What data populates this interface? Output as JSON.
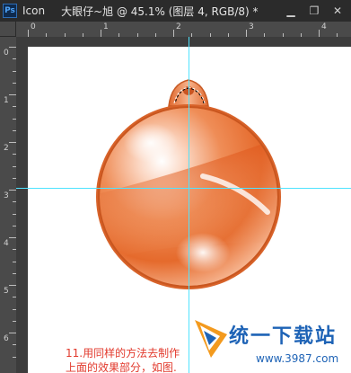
{
  "window": {
    "app_name": "Icon",
    "document_title": "大眼仔~旭 @ 45.1% (图层 4, RGB/8) *",
    "minimize_label": "▁",
    "restore_label": "❐",
    "close_label": "✕"
  },
  "ruler": {
    "top_ticks": [
      "0",
      "1",
      "2",
      "3",
      "4",
      "5"
    ],
    "left_ticks": [
      "0",
      "1",
      "2",
      "3",
      "4",
      "5",
      "6"
    ]
  },
  "caption": {
    "line1": "11.用同样的方法去制作",
    "line2": "上面的效果部分，如图."
  },
  "watermark": {
    "text": "统一下载站",
    "url": "www.3987.com"
  },
  "colors": {
    "guide": "#4fe3ff",
    "ornament": "#e2672a",
    "caption": "#e23a2d"
  }
}
